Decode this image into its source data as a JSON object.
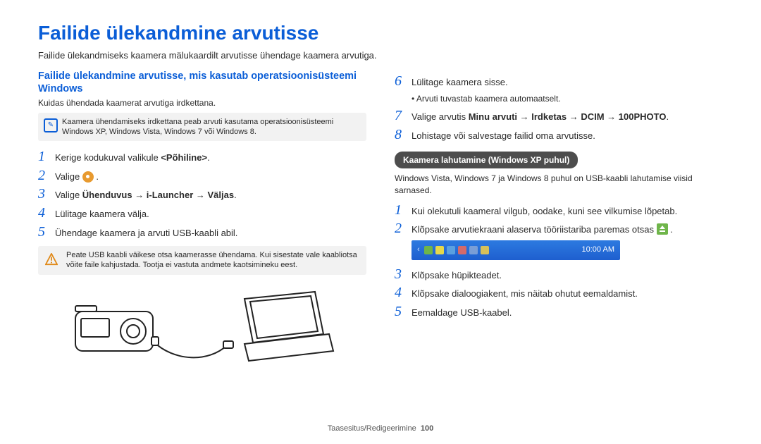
{
  "title": "Failide ülekandmine arvutisse",
  "intro": "Failide ülekandmiseks kaamera mälukaardilt arvutisse ühendage kaamera arvutiga.",
  "section_heading": "Failide ülekandmine arvutisse, mis kasutab operatsioonisüsteemi Windows",
  "section_sub": "Kuidas ühendada kaamerat arvutiga irdkettana.",
  "info_note": "Kaamera ühendamiseks irdkettana peab arvuti kasutama operatsioonisüsteemi Windows XP, Windows Vista, Windows 7 või Windows 8.",
  "left_steps": {
    "s1_prefix": "Kerige kodukuval valikule ",
    "s1_bold": "<Põhiline>",
    "s2": "Valige ",
    "s3_prefix": "Valige ",
    "s3_bold": "Ühenduvus → i-Launcher → Väljas",
    "s4": "Lülitage kaamera välja.",
    "s5": "Ühendage kaamera ja arvuti USB-kaabli abil."
  },
  "warn_note": "Peate USB kaabli väikese otsa kaamerasse ühendama. Kui sisestate vale kaabliotsa võite faile kahjustada. Tootja ei vastuta andmete kaotsimineku eest.",
  "right_steps_a": {
    "s6": "Lülitage kaamera sisse.",
    "s6_bullet": "Arvuti tuvastab kaamera automaatselt.",
    "s7_prefix": "Valige arvutis ",
    "s7_bold": "Minu arvuti → Irdketas → DCIM → 100PHOTO",
    "s8": "Lohistage või salvestage failid oma arvutisse."
  },
  "pill": "Kaamera lahutamine (Windows XP puhul)",
  "pill_after": "Windows Vista, Windows 7 ja Windows 8 puhul on USB-kaabli lahutamise viisid sarnased.",
  "right_steps_b": {
    "s1": "Kui olekutuli kaameral vilgub, oodake, kuni see vilkumise lõpetab.",
    "s2": "Klõpsake arvutiekraani alaserva tööriistariba paremas otsas ",
    "s3": "Klõpsake hüpikteadet.",
    "s4": "Klõpsake dialoogiakent, mis näitab ohutut eemaldamist.",
    "s5": "Eemaldage USB-kaabel."
  },
  "taskbar_clock": "10:00 AM",
  "footer_section": "Taasesitus/Redigeerimine",
  "footer_page": "100"
}
